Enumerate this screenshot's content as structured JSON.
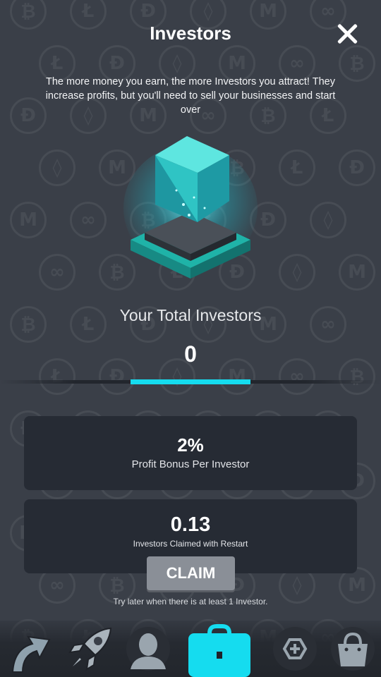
{
  "header": {
    "title": "Investors"
  },
  "description": "The more money you earn, the more Investors you attract! They increase profits, but you'll need to sell your businesses and start over",
  "total": {
    "label": "Your Total Investors",
    "value": "0",
    "progress": 0
  },
  "bonus_card": {
    "value": "2%",
    "label": "Profit Bonus Per Investor"
  },
  "claim_card": {
    "value": "0.13",
    "label": "Investors Claimed with Restart",
    "button": "CLAIM"
  },
  "hint": "Try later when there is at least 1 Investor.",
  "nav": [
    {
      "icon": "upgrade-arrow-icon"
    },
    {
      "icon": "rocket-icon"
    },
    {
      "icon": "manager-icon"
    },
    {
      "icon": "briefcase-icon",
      "active": true
    },
    {
      "icon": "hexagon-plus-icon"
    },
    {
      "icon": "shop-bag-icon"
    }
  ],
  "colors": {
    "accent": "#15dcef",
    "background": "#3a3f48",
    "card": "#262b34"
  }
}
